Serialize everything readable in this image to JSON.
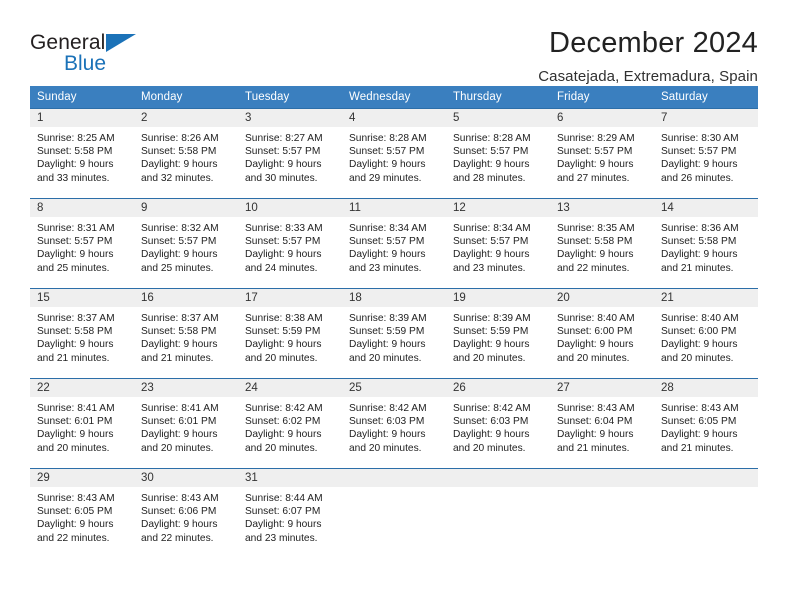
{
  "brand": {
    "name_part1": "General",
    "name_part2": "Blue",
    "triangle_color": "#1b72b8"
  },
  "header": {
    "title": "December 2024",
    "subtitle": "Casatejada, Extremadura, Spain"
  },
  "theme": {
    "header_bg": "#3a7fbf",
    "daynum_bg": "#efefef",
    "row_border": "#2c6ea8"
  },
  "weekday_headers": [
    "Sunday",
    "Monday",
    "Tuesday",
    "Wednesday",
    "Thursday",
    "Friday",
    "Saturday"
  ],
  "weeks": [
    [
      {
        "day": "1",
        "sunrise": "Sunrise: 8:25 AM",
        "sunset": "Sunset: 5:58 PM",
        "daylight_line1": "Daylight: 9 hours",
        "daylight_line2": "and 33 minutes."
      },
      {
        "day": "2",
        "sunrise": "Sunrise: 8:26 AM",
        "sunset": "Sunset: 5:58 PM",
        "daylight_line1": "Daylight: 9 hours",
        "daylight_line2": "and 32 minutes."
      },
      {
        "day": "3",
        "sunrise": "Sunrise: 8:27 AM",
        "sunset": "Sunset: 5:57 PM",
        "daylight_line1": "Daylight: 9 hours",
        "daylight_line2": "and 30 minutes."
      },
      {
        "day": "4",
        "sunrise": "Sunrise: 8:28 AM",
        "sunset": "Sunset: 5:57 PM",
        "daylight_line1": "Daylight: 9 hours",
        "daylight_line2": "and 29 minutes."
      },
      {
        "day": "5",
        "sunrise": "Sunrise: 8:28 AM",
        "sunset": "Sunset: 5:57 PM",
        "daylight_line1": "Daylight: 9 hours",
        "daylight_line2": "and 28 minutes."
      },
      {
        "day": "6",
        "sunrise": "Sunrise: 8:29 AM",
        "sunset": "Sunset: 5:57 PM",
        "daylight_line1": "Daylight: 9 hours",
        "daylight_line2": "and 27 minutes."
      },
      {
        "day": "7",
        "sunrise": "Sunrise: 8:30 AM",
        "sunset": "Sunset: 5:57 PM",
        "daylight_line1": "Daylight: 9 hours",
        "daylight_line2": "and 26 minutes."
      }
    ],
    [
      {
        "day": "8",
        "sunrise": "Sunrise: 8:31 AM",
        "sunset": "Sunset: 5:57 PM",
        "daylight_line1": "Daylight: 9 hours",
        "daylight_line2": "and 25 minutes."
      },
      {
        "day": "9",
        "sunrise": "Sunrise: 8:32 AM",
        "sunset": "Sunset: 5:57 PM",
        "daylight_line1": "Daylight: 9 hours",
        "daylight_line2": "and 25 minutes."
      },
      {
        "day": "10",
        "sunrise": "Sunrise: 8:33 AM",
        "sunset": "Sunset: 5:57 PM",
        "daylight_line1": "Daylight: 9 hours",
        "daylight_line2": "and 24 minutes."
      },
      {
        "day": "11",
        "sunrise": "Sunrise: 8:34 AM",
        "sunset": "Sunset: 5:57 PM",
        "daylight_line1": "Daylight: 9 hours",
        "daylight_line2": "and 23 minutes."
      },
      {
        "day": "12",
        "sunrise": "Sunrise: 8:34 AM",
        "sunset": "Sunset: 5:57 PM",
        "daylight_line1": "Daylight: 9 hours",
        "daylight_line2": "and 23 minutes."
      },
      {
        "day": "13",
        "sunrise": "Sunrise: 8:35 AM",
        "sunset": "Sunset: 5:58 PM",
        "daylight_line1": "Daylight: 9 hours",
        "daylight_line2": "and 22 minutes."
      },
      {
        "day": "14",
        "sunrise": "Sunrise: 8:36 AM",
        "sunset": "Sunset: 5:58 PM",
        "daylight_line1": "Daylight: 9 hours",
        "daylight_line2": "and 21 minutes."
      }
    ],
    [
      {
        "day": "15",
        "sunrise": "Sunrise: 8:37 AM",
        "sunset": "Sunset: 5:58 PM",
        "daylight_line1": "Daylight: 9 hours",
        "daylight_line2": "and 21 minutes."
      },
      {
        "day": "16",
        "sunrise": "Sunrise: 8:37 AM",
        "sunset": "Sunset: 5:58 PM",
        "daylight_line1": "Daylight: 9 hours",
        "daylight_line2": "and 21 minutes."
      },
      {
        "day": "17",
        "sunrise": "Sunrise: 8:38 AM",
        "sunset": "Sunset: 5:59 PM",
        "daylight_line1": "Daylight: 9 hours",
        "daylight_line2": "and 20 minutes."
      },
      {
        "day": "18",
        "sunrise": "Sunrise: 8:39 AM",
        "sunset": "Sunset: 5:59 PM",
        "daylight_line1": "Daylight: 9 hours",
        "daylight_line2": "and 20 minutes."
      },
      {
        "day": "19",
        "sunrise": "Sunrise: 8:39 AM",
        "sunset": "Sunset: 5:59 PM",
        "daylight_line1": "Daylight: 9 hours",
        "daylight_line2": "and 20 minutes."
      },
      {
        "day": "20",
        "sunrise": "Sunrise: 8:40 AM",
        "sunset": "Sunset: 6:00 PM",
        "daylight_line1": "Daylight: 9 hours",
        "daylight_line2": "and 20 minutes."
      },
      {
        "day": "21",
        "sunrise": "Sunrise: 8:40 AM",
        "sunset": "Sunset: 6:00 PM",
        "daylight_line1": "Daylight: 9 hours",
        "daylight_line2": "and 20 minutes."
      }
    ],
    [
      {
        "day": "22",
        "sunrise": "Sunrise: 8:41 AM",
        "sunset": "Sunset: 6:01 PM",
        "daylight_line1": "Daylight: 9 hours",
        "daylight_line2": "and 20 minutes."
      },
      {
        "day": "23",
        "sunrise": "Sunrise: 8:41 AM",
        "sunset": "Sunset: 6:01 PM",
        "daylight_line1": "Daylight: 9 hours",
        "daylight_line2": "and 20 minutes."
      },
      {
        "day": "24",
        "sunrise": "Sunrise: 8:42 AM",
        "sunset": "Sunset: 6:02 PM",
        "daylight_line1": "Daylight: 9 hours",
        "daylight_line2": "and 20 minutes."
      },
      {
        "day": "25",
        "sunrise": "Sunrise: 8:42 AM",
        "sunset": "Sunset: 6:03 PM",
        "daylight_line1": "Daylight: 9 hours",
        "daylight_line2": "and 20 minutes."
      },
      {
        "day": "26",
        "sunrise": "Sunrise: 8:42 AM",
        "sunset": "Sunset: 6:03 PM",
        "daylight_line1": "Daylight: 9 hours",
        "daylight_line2": "and 20 minutes."
      },
      {
        "day": "27",
        "sunrise": "Sunrise: 8:43 AM",
        "sunset": "Sunset: 6:04 PM",
        "daylight_line1": "Daylight: 9 hours",
        "daylight_line2": "and 21 minutes."
      },
      {
        "day": "28",
        "sunrise": "Sunrise: 8:43 AM",
        "sunset": "Sunset: 6:05 PM",
        "daylight_line1": "Daylight: 9 hours",
        "daylight_line2": "and 21 minutes."
      }
    ],
    [
      {
        "day": "29",
        "sunrise": "Sunrise: 8:43 AM",
        "sunset": "Sunset: 6:05 PM",
        "daylight_line1": "Daylight: 9 hours",
        "daylight_line2": "and 22 minutes."
      },
      {
        "day": "30",
        "sunrise": "Sunrise: 8:43 AM",
        "sunset": "Sunset: 6:06 PM",
        "daylight_line1": "Daylight: 9 hours",
        "daylight_line2": "and 22 minutes."
      },
      {
        "day": "31",
        "sunrise": "Sunrise: 8:44 AM",
        "sunset": "Sunset: 6:07 PM",
        "daylight_line1": "Daylight: 9 hours",
        "daylight_line2": "and 23 minutes."
      },
      {
        "day": "",
        "sunrise": "",
        "sunset": "",
        "daylight_line1": "",
        "daylight_line2": ""
      },
      {
        "day": "",
        "sunrise": "",
        "sunset": "",
        "daylight_line1": "",
        "daylight_line2": ""
      },
      {
        "day": "",
        "sunrise": "",
        "sunset": "",
        "daylight_line1": "",
        "daylight_line2": ""
      },
      {
        "day": "",
        "sunrise": "",
        "sunset": "",
        "daylight_line1": "",
        "daylight_line2": ""
      }
    ]
  ]
}
